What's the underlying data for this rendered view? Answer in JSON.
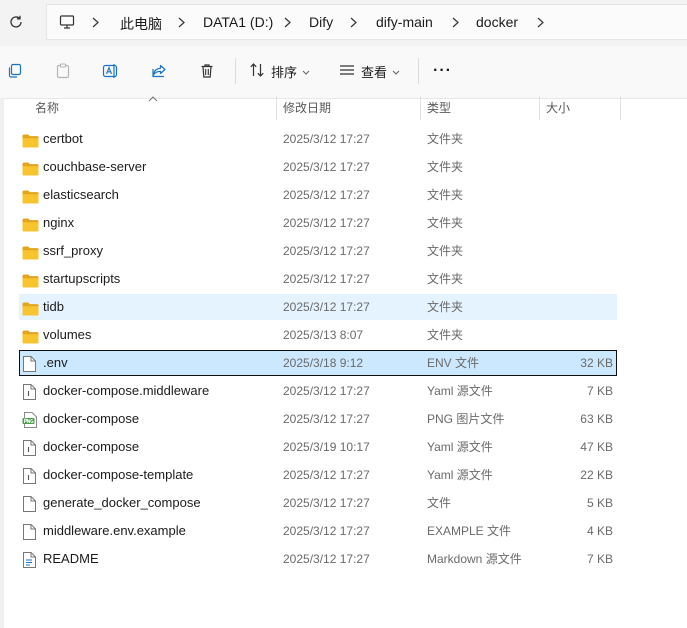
{
  "address_bar": {
    "crumbs": [
      "此电脑",
      "DATA1 (D:)",
      "Dify",
      "dify-main",
      "docker"
    ]
  },
  "toolbar": {
    "sort_label": "排序",
    "view_label": "查看",
    "more_label": "···"
  },
  "columns": {
    "name": "名称",
    "date": "修改日期",
    "type": "类型",
    "size": "大小"
  },
  "rows": [
    {
      "name": "certbot",
      "date": "2025/3/12 17:27",
      "type": "文件夹",
      "size": "",
      "icon": "folder-icon"
    },
    {
      "name": "couchbase-server",
      "date": "2025/3/12 17:27",
      "type": "文件夹",
      "size": "",
      "icon": "folder-icon"
    },
    {
      "name": "elasticsearch",
      "date": "2025/3/12 17:27",
      "type": "文件夹",
      "size": "",
      "icon": "folder-icon"
    },
    {
      "name": "nginx",
      "date": "2025/3/12 17:27",
      "type": "文件夹",
      "size": "",
      "icon": "folder-icon"
    },
    {
      "name": "ssrf_proxy",
      "date": "2025/3/12 17:27",
      "type": "文件夹",
      "size": "",
      "icon": "folder-icon"
    },
    {
      "name": "startupscripts",
      "date": "2025/3/12 17:27",
      "type": "文件夹",
      "size": "",
      "icon": "folder-icon"
    },
    {
      "name": "tidb",
      "date": "2025/3/12 17:27",
      "type": "文件夹",
      "size": "",
      "icon": "folder-icon"
    },
    {
      "name": "volumes",
      "date": "2025/3/13 8:07",
      "type": "文件夹",
      "size": "",
      "icon": "folder-icon"
    },
    {
      "name": ".env",
      "date": "2025/3/18 9:12",
      "type": "ENV 文件",
      "size": "32 KB",
      "icon": "file-icon"
    },
    {
      "name": "docker-compose.middleware",
      "date": "2025/3/12 17:27",
      "type": "Yaml 源文件",
      "size": "7 KB",
      "icon": "yaml-file-icon"
    },
    {
      "name": "docker-compose",
      "date": "2025/3/12 17:27",
      "type": "PNG 图片文件",
      "size": "63 KB",
      "icon": "png-file-icon"
    },
    {
      "name": "docker-compose",
      "date": "2025/3/19 10:17",
      "type": "Yaml 源文件",
      "size": "47 KB",
      "icon": "yaml-file-icon"
    },
    {
      "name": "docker-compose-template",
      "date": "2025/3/12 17:27",
      "type": "Yaml 源文件",
      "size": "22 KB",
      "icon": "yaml-file-icon"
    },
    {
      "name": "generate_docker_compose",
      "date": "2025/3/12 17:27",
      "type": "文件",
      "size": "5 KB",
      "icon": "file-icon"
    },
    {
      "name": "middleware.env.example",
      "date": "2025/3/12 17:27",
      "type": "EXAMPLE 文件",
      "size": "4 KB",
      "icon": "file-icon"
    },
    {
      "name": "README",
      "date": "2025/3/12 17:27",
      "type": "Markdown 源文件",
      "size": "7 KB",
      "icon": "markdown-file-icon"
    }
  ],
  "state": {
    "hovered_row": "tidb",
    "selected_row": ".env"
  },
  "colors": {
    "hover_bg": "#e5f3ff",
    "selected_bg": "#cce8ff",
    "folder_yellow": "#f8c42f",
    "folder_dark": "#e3a51b"
  }
}
